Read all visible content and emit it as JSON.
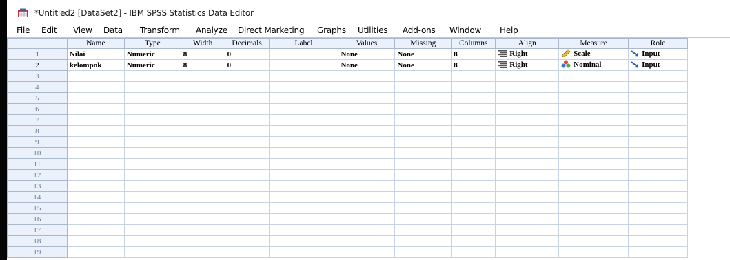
{
  "window": {
    "title": "*Untitled2 [DataSet2] - IBM SPSS Statistics Data Editor"
  },
  "menu": [
    {
      "pre": "",
      "u": "F",
      "post": "ile",
      "name": "menu-file"
    },
    {
      "pre": "",
      "u": "E",
      "post": "dit",
      "name": "menu-edit"
    },
    {
      "pre": "",
      "u": "V",
      "post": "iew",
      "name": "menu-view"
    },
    {
      "pre": "",
      "u": "D",
      "post": "ata",
      "name": "menu-data"
    },
    {
      "pre": "",
      "u": "T",
      "post": "ransform",
      "name": "menu-transform"
    },
    {
      "pre": "",
      "u": "A",
      "post": "nalyze",
      "name": "menu-analyze"
    },
    {
      "pre": "Direct ",
      "u": "M",
      "post": "arketing",
      "name": "menu-direct-marketing"
    },
    {
      "pre": "",
      "u": "G",
      "post": "raphs",
      "name": "menu-graphs"
    },
    {
      "pre": "",
      "u": "U",
      "post": "tilities",
      "name": "menu-utilities"
    },
    {
      "pre": "Add-",
      "u": "o",
      "post": "ns",
      "name": "menu-add-ons"
    },
    {
      "pre": "",
      "u": "W",
      "post": "indow",
      "name": "menu-window"
    },
    {
      "pre": "",
      "u": "H",
      "post": "elp",
      "name": "menu-help"
    }
  ],
  "columns": [
    "Name",
    "Type",
    "Width",
    "Decimals",
    "Label",
    "Values",
    "Missing",
    "Columns",
    "Align",
    "Measure",
    "Role"
  ],
  "variables": [
    {
      "name": "Nilai",
      "type": "Numeric",
      "width": "8",
      "decimals": "0",
      "label": "",
      "values": "None",
      "missing": "None",
      "columns": "8",
      "align": "Right",
      "align_icon": "align-right-icon",
      "measure": "Scale",
      "measure_icon": "scale-ruler-icon",
      "role": "Input",
      "role_icon": "input-arrow-icon"
    },
    {
      "name": "kelompok",
      "type": "Numeric",
      "width": "8",
      "decimals": "0",
      "label": "",
      "values": "None",
      "missing": "None",
      "columns": "8",
      "align": "Right",
      "align_icon": "align-right-icon",
      "measure": "Nominal",
      "measure_icon": "nominal-shapes-icon",
      "role": "Input",
      "role_icon": "input-arrow-icon"
    }
  ],
  "row_numbers": [
    "1",
    "2",
    "3",
    "4",
    "5",
    "6",
    "7",
    "8",
    "9",
    "10",
    "11",
    "12",
    "13",
    "14",
    "15",
    "16",
    "17",
    "18",
    "19"
  ],
  "colors": {
    "header_bg": "#eaf1fb",
    "grid_line": "#c8d3e2"
  }
}
